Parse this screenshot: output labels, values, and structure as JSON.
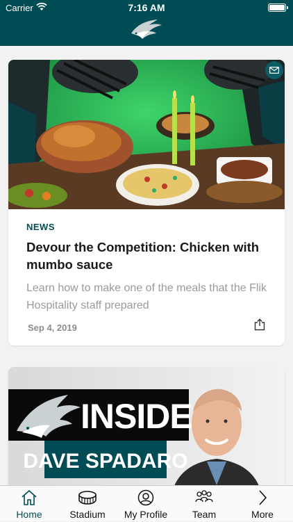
{
  "status_bar": {
    "carrier": "Carrier",
    "time": "7:16 AM"
  },
  "colors": {
    "brand": "#004c54",
    "midnight_green": "#004c54",
    "tab_active": "#004c54"
  },
  "feed": {
    "article": {
      "category": "NEWS",
      "title": "Devour the Competition: Chicken with mumbo sauce",
      "description": "Learn how to make one of the meals that the Flik Hospitality staff prepared",
      "date": "Sep 4, 2019"
    },
    "insider": {
      "headline": "INSIDER",
      "name": "DAVE SPADARO"
    }
  },
  "tabs": [
    {
      "label": "Home",
      "icon": "home-icon",
      "active": true
    },
    {
      "label": "Stadium",
      "icon": "stadium-icon",
      "active": false
    },
    {
      "label": "My Profile",
      "icon": "profile-icon",
      "active": false
    },
    {
      "label": "Team",
      "icon": "team-icon",
      "active": false
    },
    {
      "label": "More",
      "icon": "chevron-right-icon",
      "active": false
    }
  ]
}
